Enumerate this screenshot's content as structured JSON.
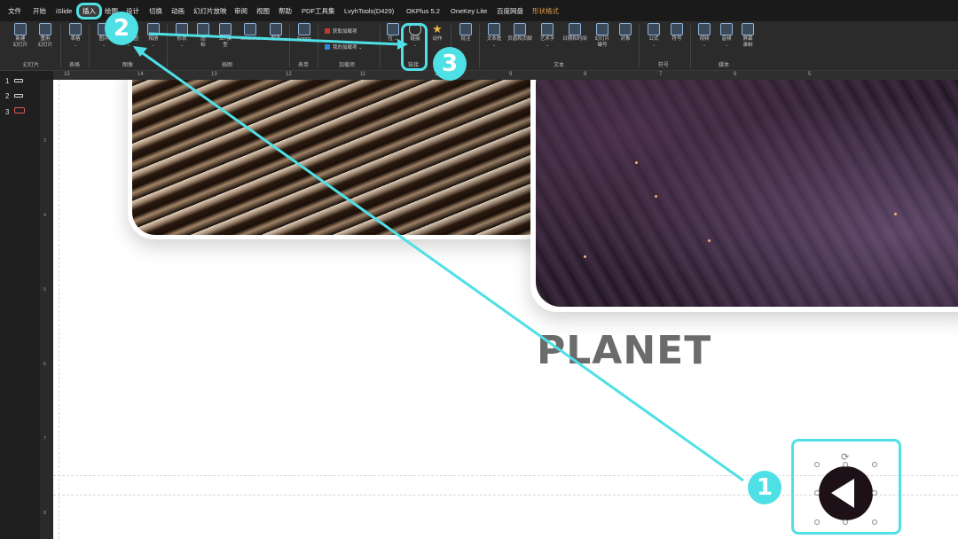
{
  "menubar": {
    "items": [
      "文件",
      "开始",
      "iSlide",
      "插入",
      "绘图",
      "设计",
      "切换",
      "动画",
      "幻灯片放映",
      "审阅",
      "视图",
      "帮助",
      "PDF工具集",
      "LvyhTools(D429)",
      "OKPlus 5.2",
      "OneKey Lite",
      "百度网盘",
      "形状格式"
    ],
    "active": "插入"
  },
  "ribbon": {
    "new_slide": "新建\n幻灯片",
    "reuse_slide": "重用\n幻灯片",
    "table": "表格",
    "picture": "图片",
    "screenshot": "屏幕截图",
    "album": "相册",
    "shapes": "形状",
    "icons": "图\n标",
    "model_3d": "3D 模\n型",
    "smartart": "SmartArt",
    "chart": "图表",
    "forms": "Forms",
    "get_addins": "获取加载项",
    "my_addins": "我的加载项",
    "position": "位",
    "link": "链接",
    "action": "动作",
    "comment": "批注",
    "textbox": "文本框",
    "header_footer": "页眉和页脚",
    "wordart": "艺术字",
    "datetime": "日期和时间",
    "slide_number": "幻灯片\n编号",
    "object": "对象",
    "equation": "公式",
    "symbol": "符号",
    "video": "视频",
    "audio": "音频",
    "screen_record": "屏幕\n录制",
    "groups": {
      "slides": "幻灯片",
      "tables": "表格",
      "images": "图像",
      "illustrations": "插图",
      "forms": "表单",
      "addins": "加载项",
      "links": "链接",
      "text": "文本",
      "symbols": "符号",
      "media": "媒体"
    }
  },
  "ruler": {
    "top": [
      "15",
      "14",
      "13",
      "12",
      "11",
      "10",
      "9",
      "8",
      "7",
      "6",
      "5"
    ],
    "left": [
      "3",
      "4",
      "5",
      "6",
      "7",
      "8"
    ]
  },
  "slides": [
    "1",
    "2",
    "3"
  ],
  "slide": {
    "title": "PLANET"
  },
  "annotations": {
    "step1": "1",
    "step2": "2",
    "step3": "3",
    "color": "#4fe0e6"
  }
}
